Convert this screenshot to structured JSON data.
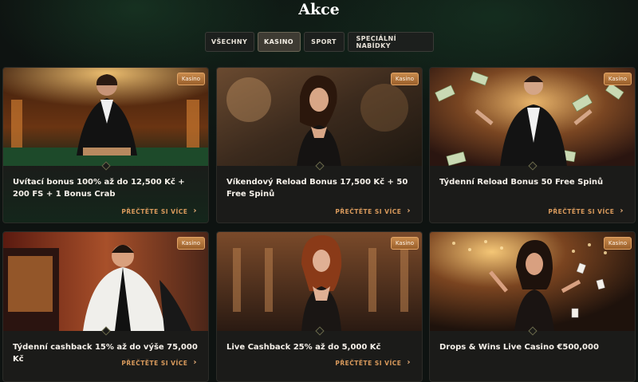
{
  "page": {
    "title": "Akce"
  },
  "tabs": [
    {
      "label": "VŠECHNY",
      "active": false
    },
    {
      "label": "KASINO",
      "active": true
    },
    {
      "label": "SPORT",
      "active": false
    },
    {
      "label": "SPECIÁLNÍ NABÍDKY",
      "active": false
    }
  ],
  "promotions": [
    {
      "badge": "Kasino",
      "title": "Uvítací bonus 100% až do 12,500 Kč + 200 FS + 1 Bonus Crab",
      "cta": "PŘEČTĚTE SI VÍCE",
      "image": "man-in-tuxedo-at-casino-table"
    },
    {
      "badge": "Kasino",
      "title": "Víkendový Reload Bonus 17,500 Kč + 50 Free Spinů",
      "cta": "PŘEČTĚTE SI VÍCE",
      "image": "woman-in-black-dress-at-bar"
    },
    {
      "badge": "Kasino",
      "title": "Týdenní Reload Bonus 50 Free Spinů",
      "cta": "PŘEČTĚTE SI VÍCE",
      "image": "man-with-flying-money"
    },
    {
      "badge": "Kasino",
      "title": "Týdenní cashback 15% až do výše 75,000 Kč",
      "cta": "PŘEČTĚTE SI VÍCE",
      "image": "man-at-slot-machine"
    },
    {
      "badge": "Kasino",
      "title": "Live Cashback 25% až do 5,000 Kč",
      "cta": "PŘEČTĚTE SI VÍCE",
      "image": "woman-in-casino-hall"
    },
    {
      "badge": "Kasino",
      "title": "Drops & Wins Live Casino €500,000",
      "cta": "",
      "image": "woman-with-cards-in-lights"
    }
  ],
  "colors": {
    "accent": "#d99a5c",
    "badge": "#b8763c",
    "background": "#0e1311",
    "card": "#1b1b19"
  },
  "icons": {
    "read_more": "chevron-right-icon"
  }
}
